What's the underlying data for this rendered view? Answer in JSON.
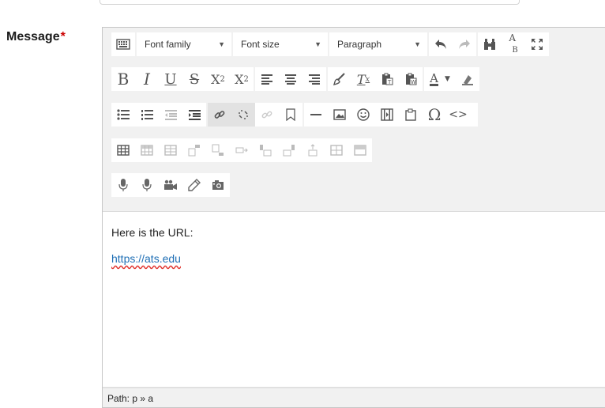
{
  "form": {
    "message_label": "Message",
    "required_mark": "*"
  },
  "toolbar": {
    "font_family_label": "Font family",
    "font_size_label": "Font size",
    "block_format_label": "Paragraph",
    "bold_label": "B",
    "italic_label": "I",
    "underline_label": "U",
    "strike_label": "S",
    "subscript_label": "X",
    "subscript_mark": "2",
    "superscript_label": "X",
    "superscript_mark": "2",
    "clear_format_label": "T",
    "clear_format_mark": "x",
    "text_color_label": "A",
    "search_replace_label": "A",
    "search_replace_mark": "B",
    "special_char_label": "Ω",
    "code_label": "<>",
    "link_active": true,
    "unlink_active": true
  },
  "content": {
    "paragraph": "Here is the URL:",
    "link_text": "https://ats.edu"
  },
  "status": {
    "path": "Path: p » a"
  },
  "icons": [
    "keyboard-icon",
    "undo-icon",
    "redo-icon",
    "binoculars-icon",
    "search-replace-icon",
    "fullscreen-icon",
    "align-left-icon",
    "align-center-icon",
    "align-right-icon",
    "brush-icon",
    "paste-text-icon",
    "paste-word-icon",
    "text-color-icon",
    "background-color-icon",
    "bullet-list-icon",
    "numbered-list-icon",
    "outdent-icon",
    "indent-icon",
    "link-icon",
    "unlink-icon",
    "anchor-link-icon",
    "bookmark-icon",
    "horizontal-rule-icon",
    "image-icon",
    "emoticon-icon",
    "media-icon",
    "manage-files-icon",
    "omega-icon",
    "code-icon",
    "table-icon",
    "microphone-icon",
    "video-camera-icon",
    "pencil-icon",
    "camera-icon"
  ]
}
